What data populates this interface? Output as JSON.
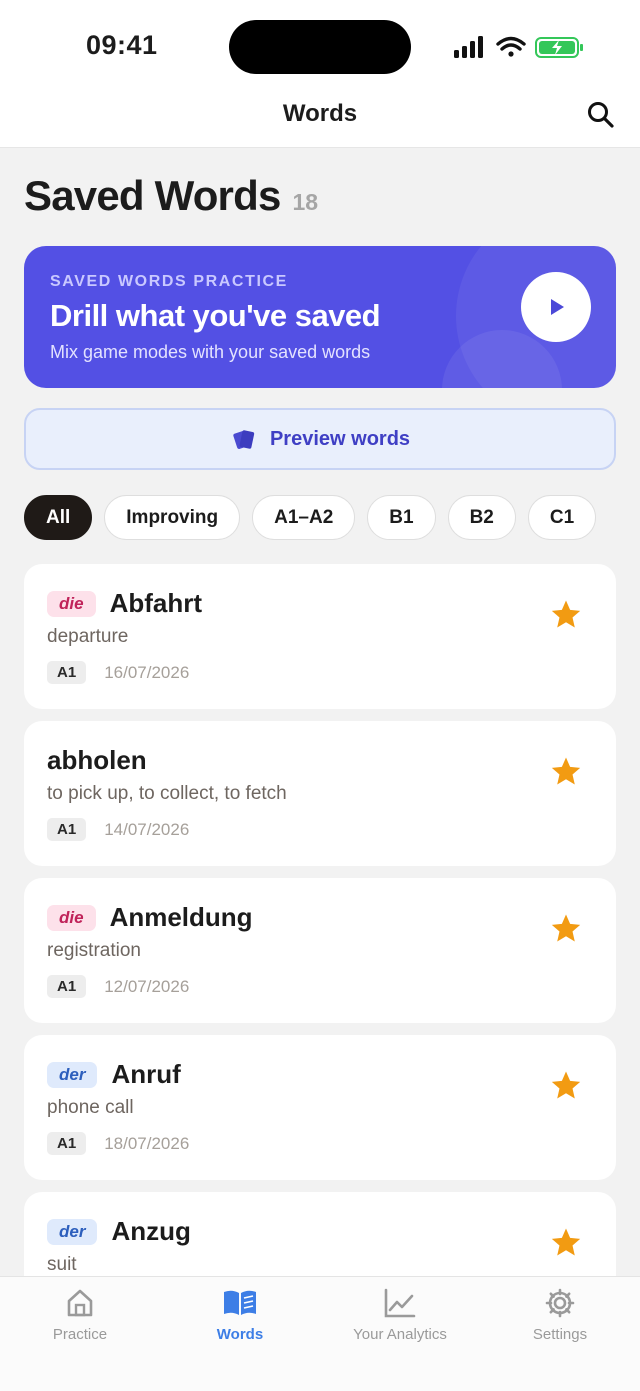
{
  "status": {
    "time": "09:41"
  },
  "nav": {
    "title": "Words"
  },
  "page": {
    "title": "Saved Words",
    "count": "18"
  },
  "banner": {
    "kicker": "SAVED WORDS PRACTICE",
    "title": "Drill what you've saved",
    "subtitle": "Mix game modes with your saved words"
  },
  "preview": {
    "label": "Preview words"
  },
  "filters": [
    "All",
    "Improving",
    "A1–A2",
    "B1",
    "B2",
    "C1"
  ],
  "active_filter": "All",
  "words": [
    {
      "article": "die",
      "word": "Abfahrt",
      "translation": "departure",
      "level": "A1",
      "date": "16/07/2026",
      "starred": true
    },
    {
      "article": "",
      "word": "abholen",
      "translation": "to pick up, to collect, to fetch",
      "level": "A1",
      "date": "14/07/2026",
      "starred": true
    },
    {
      "article": "die",
      "word": "Anmeldung",
      "translation": "registration",
      "level": "A1",
      "date": "12/07/2026",
      "starred": true
    },
    {
      "article": "der",
      "word": "Anruf",
      "translation": "phone call",
      "level": "A1",
      "date": "18/07/2026",
      "starred": true
    },
    {
      "article": "der",
      "word": "Anzug",
      "translation": "suit",
      "level": "",
      "date": "",
      "starred": true
    }
  ],
  "tabs": [
    {
      "label": "Practice",
      "icon": "home-icon",
      "active": false
    },
    {
      "label": "Words",
      "icon": "book-icon",
      "active": true
    },
    {
      "label": "Your Analytics",
      "icon": "chart-icon",
      "active": false
    },
    {
      "label": "Settings",
      "icon": "gear-icon",
      "active": false
    }
  ],
  "colors": {
    "accent": "#5350e4",
    "tab_active": "#3d7ee6",
    "star": "#f29b12"
  }
}
